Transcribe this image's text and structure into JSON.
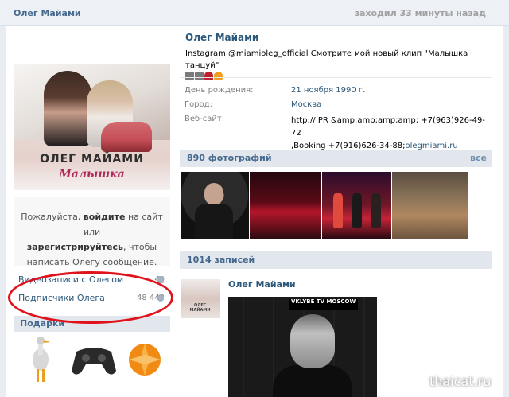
{
  "topbar": {
    "name": "Олег Майами",
    "last_seen": "заходил 33 минуты назад"
  },
  "avatar": {
    "title": "ОЛЕГ МАЙАМИ",
    "subtitle": "Малышка"
  },
  "login_box": {
    "line1_pre": "Пожалуйста, ",
    "login_link": "войдите",
    "line1_post": " на сайт или",
    "register_link": "зарегистрируйтесь",
    "line2_post": ", чтобы",
    "line3": "написать Олегу сообщение."
  },
  "sidebar": {
    "videos_label": "Видеозаписи с Олегом",
    "videos_count": "40",
    "followers_label": "Подписчики Олега",
    "followers_count": "48 442",
    "gifts_label": "Подарки"
  },
  "profile": {
    "name": "Олег Майами",
    "status": "Instagram @miamioleg_official Смотрите мой новый клип \"Малышка танцуй\"",
    "birthday_label": "День рождения:",
    "birthday_value": "21 ноября 1990 г.",
    "city_label": "Город:",
    "city_value": "Москва",
    "website_label": "Веб-сайт:",
    "website_value_1": "http:// PR &amp;amp;amp;amp; +7(963)926-49-72",
    "website_value_2": ",Booking +7(916)626-34-88;",
    "website_link": "olegmiami.ru"
  },
  "photos": {
    "title": "890 фотографий",
    "all_label": "все"
  },
  "posts": {
    "title": "1014 записей",
    "author": "Олег Майами",
    "avatar_caption": "ОЛЕГ МАЙАМИ",
    "image_tag": "VKLYBE TV MOSCOW"
  },
  "watermark": "thaicat.ru",
  "colors": {
    "link": "#2b587a",
    "header_bg": "#e1e7ed",
    "highlight": "#e0131d"
  }
}
